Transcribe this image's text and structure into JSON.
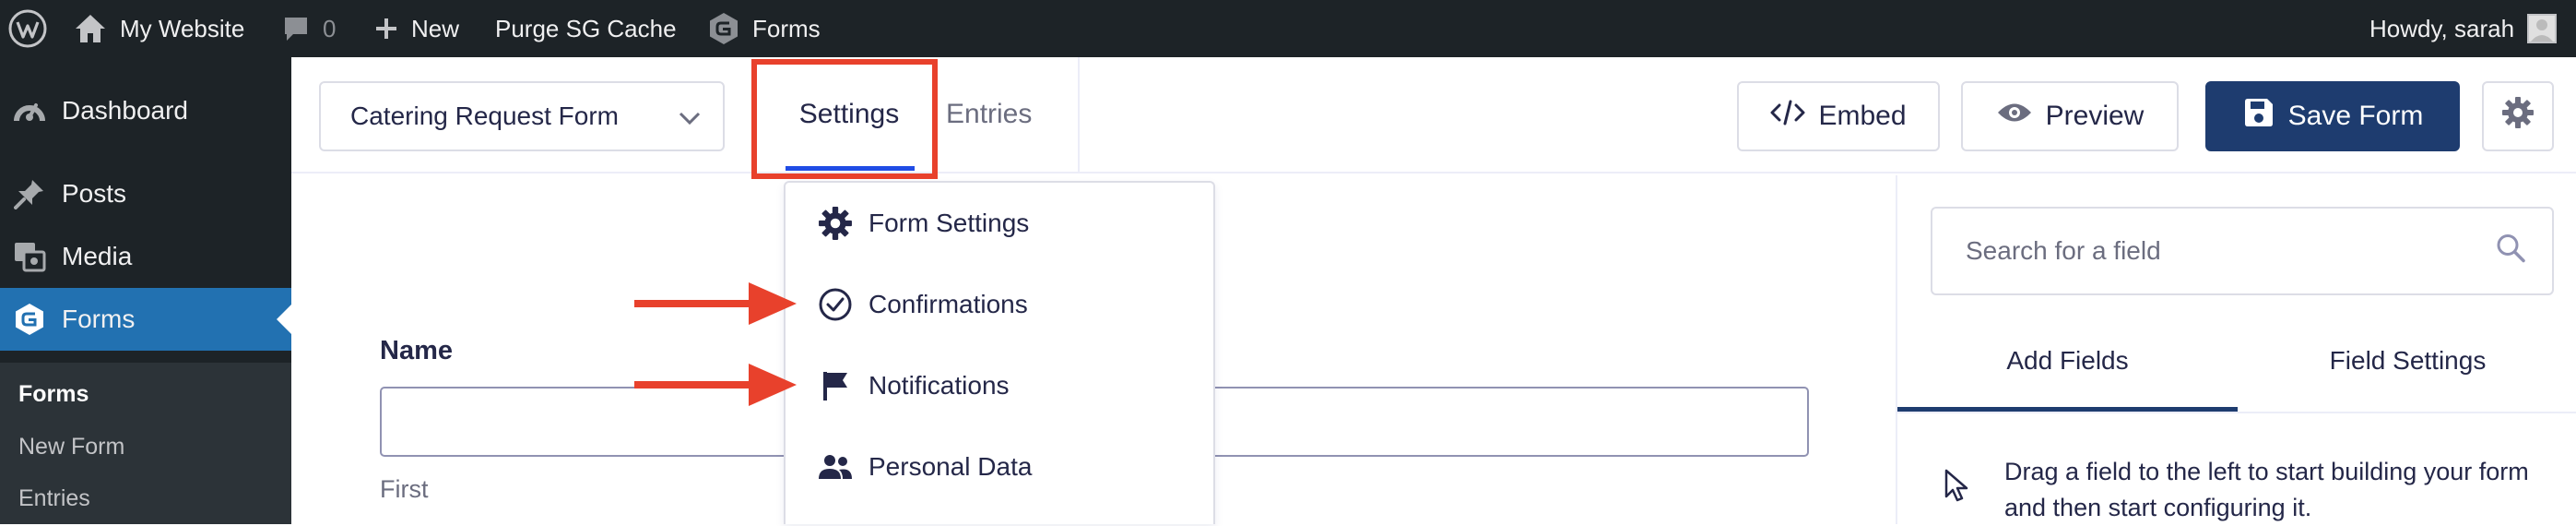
{
  "colors": {
    "admin_bar": "#1d2327",
    "menu_active": "#2271b1",
    "save_button": "#1e3c6f",
    "annotation": "#e8412c"
  },
  "admin_bar": {
    "site_name": "My Website",
    "comments_count": "0",
    "new_label": "New",
    "purge_label": "Purge SG Cache",
    "forms_label": "Forms",
    "greeting": "Howdy, sarah"
  },
  "sidebar": {
    "items": [
      {
        "label": "Dashboard",
        "icon": "dashboard-icon"
      },
      {
        "label": "Posts",
        "icon": "pin-icon"
      },
      {
        "label": "Media",
        "icon": "media-icon"
      },
      {
        "label": "Forms",
        "icon": "gravity-forms-icon",
        "active": true
      }
    ],
    "submenu": [
      {
        "label": "Forms",
        "current": true
      },
      {
        "label": "New Form"
      },
      {
        "label": "Entries"
      }
    ]
  },
  "header": {
    "form_selector": "Catering Request Form",
    "tabs": {
      "settings": "Settings",
      "entries": "Entries"
    },
    "embed_label": "Embed",
    "preview_label": "Preview",
    "save_label": "Save Form"
  },
  "settings_menu": {
    "items": [
      {
        "label": "Form Settings",
        "icon": "gear-icon"
      },
      {
        "label": "Confirmations",
        "icon": "check-circle-icon"
      },
      {
        "label": "Notifications",
        "icon": "flag-icon"
      },
      {
        "label": "Personal Data",
        "icon": "people-icon"
      }
    ]
  },
  "canvas": {
    "name_label": "Name",
    "first_label": "First"
  },
  "field_panel": {
    "search_placeholder": "Search for a field",
    "tabs": {
      "add_fields": "Add Fields",
      "field_settings": "Field Settings"
    },
    "hint": "Drag a field to the left to start building your form and then start configuring it."
  }
}
